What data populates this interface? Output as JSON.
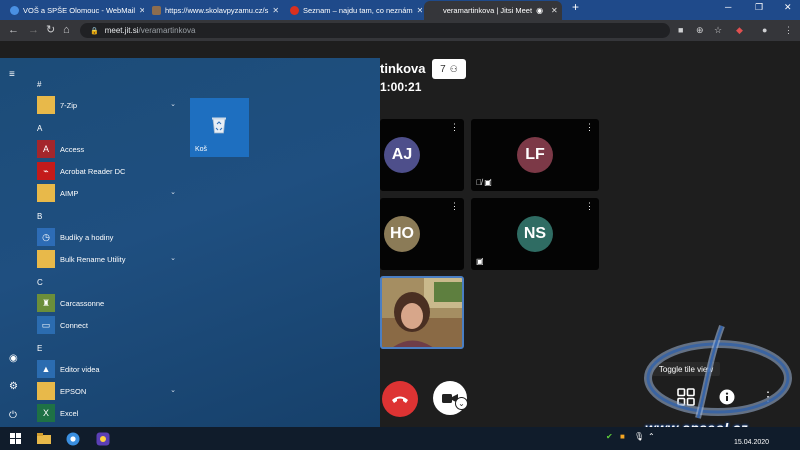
{
  "browser": {
    "tabs": [
      {
        "title": "VOŠ a SPŠE Olomouc - WebMail",
        "color": "#4a90e2"
      },
      {
        "title": "https://www.skolavpyzamu.cz/s",
        "color": "#8c6d4f"
      },
      {
        "title": "Seznam – najdu tam, co neznám",
        "color": "#d9301f"
      },
      {
        "title": "veramartinkova | Jitsi Meet",
        "color": "#35363a"
      }
    ],
    "new_tab_label": "+",
    "url_domain": "meet.jit.si",
    "url_path": "/veramartinkova"
  },
  "meeting": {
    "title_fragment": "tinkova",
    "timer": "1:00:21",
    "participant_count": "7",
    "tooltip": "Toggle tile view",
    "tiles": [
      {
        "initials": "AJ",
        "color": "#4e4f8b"
      },
      {
        "initials": "LF",
        "color": "#7c3947"
      },
      {
        "initials": "HO",
        "color": "#8b7b57"
      },
      {
        "initials": "NS",
        "color": "#2f6c63"
      }
    ]
  },
  "start_menu": {
    "groups": [
      {
        "letter": "#",
        "apps": [
          {
            "label": "7-Zip",
            "icon": "folder-icon",
            "color": "#e8b94a",
            "expandable": true
          }
        ]
      },
      {
        "letter": "A",
        "apps": [
          {
            "label": "Access",
            "icon": "access-icon",
            "color": "#a4262c",
            "expandable": false
          },
          {
            "label": "Acrobat Reader DC",
            "icon": "acrobat-icon",
            "color": "#c41a1a",
            "expandable": false
          },
          {
            "label": "AIMP",
            "icon": "folder-icon",
            "color": "#e8b94a",
            "expandable": true
          }
        ]
      },
      {
        "letter": "B",
        "apps": [
          {
            "label": "Budíky a hodiny",
            "icon": "alarm-clock-icon",
            "color": "#2d6cb6",
            "expandable": false
          },
          {
            "label": "Bulk Rename Utility",
            "icon": "folder-icon",
            "color": "#e8b94a",
            "expandable": true
          }
        ]
      },
      {
        "letter": "C",
        "apps": [
          {
            "label": "Carcassonne",
            "icon": "carcassonne-icon",
            "color": "#6b8e3a",
            "expandable": false
          },
          {
            "label": "Connect",
            "icon": "connect-icon",
            "color": "#2b6cb0",
            "expandable": false
          }
        ]
      },
      {
        "letter": "E",
        "apps": [
          {
            "label": "Editor videa",
            "icon": "video-editor-icon",
            "color": "#2b6cb0",
            "expandable": false
          },
          {
            "label": "EPSON",
            "icon": "folder-icon",
            "color": "#e8b94a",
            "expandable": true
          },
          {
            "label": "Excel",
            "icon": "excel-icon",
            "color": "#1e7145",
            "expandable": false
          }
        ]
      }
    ],
    "pinned_tile": {
      "label": "Koš",
      "icon": "recycle-bin-icon"
    }
  },
  "taskbar": {
    "date": "15.04.2020"
  },
  "watermark": {
    "text": "www.spseol.cz"
  }
}
